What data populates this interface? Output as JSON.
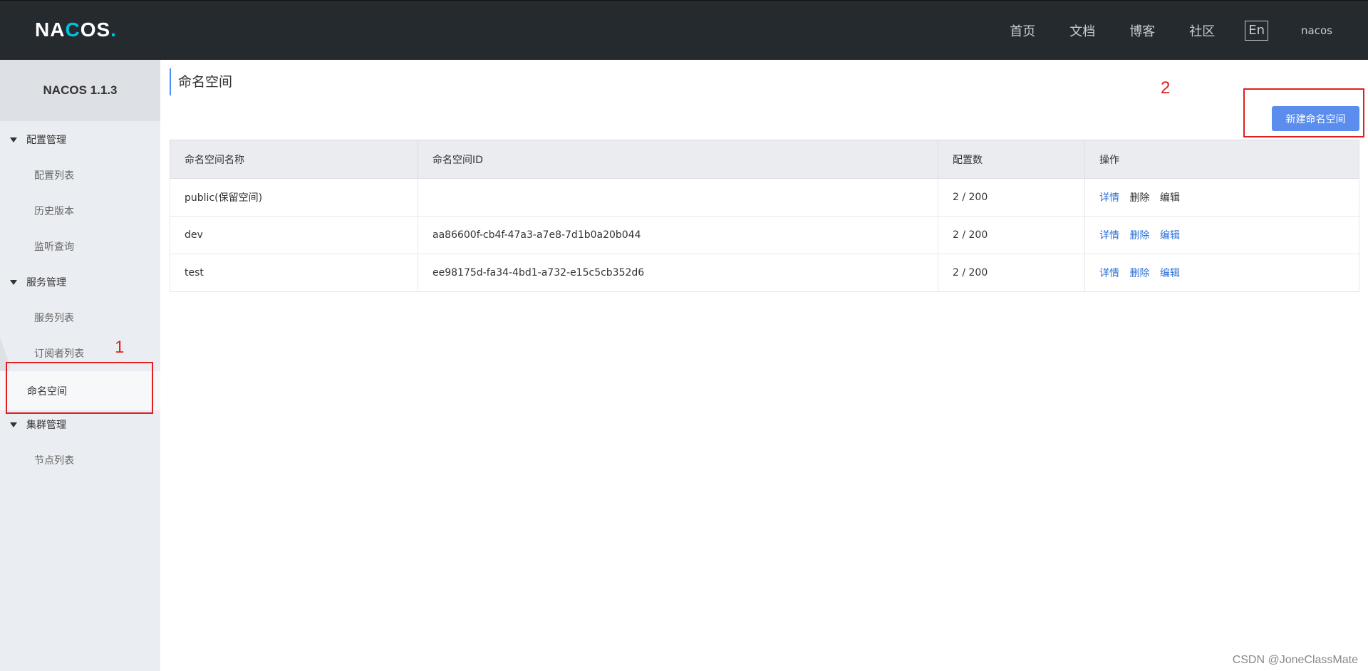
{
  "header": {
    "logo_text_1": "NA",
    "logo_text_2": "C",
    "logo_text_3": "OS",
    "logo_dot": ".",
    "nav": [
      "首页",
      "文档",
      "博客",
      "社区"
    ],
    "lang": "En",
    "user": "nacos"
  },
  "sidebar": {
    "title": "NACOS 1.1.3",
    "groups": [
      {
        "label": "配置管理",
        "items": [
          "配置列表",
          "历史版本",
          "监听查询"
        ]
      },
      {
        "label": "服务管理",
        "items": [
          "服务列表",
          "订阅者列表",
          "命名空间"
        ]
      },
      {
        "label": "集群管理",
        "items": [
          "节点列表"
        ]
      }
    ],
    "active_item": "命名空间"
  },
  "main": {
    "page_title": "命名空间",
    "create_button": "新建命名空间",
    "table": {
      "headers": [
        "命名空间名称",
        "命名空间ID",
        "配置数",
        "操作"
      ],
      "rows": [
        {
          "name": "public(保留空间)",
          "id": "",
          "count": "2 / 200",
          "ops": [
            "详情",
            "删除",
            "编辑"
          ]
        },
        {
          "name": "dev",
          "id": "aa86600f-cb4f-47a3-a7e8-7d1b0a20b044",
          "count": "2 / 200",
          "ops": [
            "详情",
            "删除",
            "编辑"
          ]
        },
        {
          "name": "test",
          "id": "ee98175d-fa34-4bd1-a732-e15c5cb352d6",
          "count": "2 / 200",
          "ops": [
            "详情",
            "删除",
            "编辑"
          ]
        }
      ]
    }
  },
  "annotations": {
    "one": "1",
    "two": "2"
  },
  "watermark": "CSDN @JoneClassMate",
  "colors": {
    "header_bg": "#252a2f",
    "accent": "#5b8def",
    "link": "#2a6fd6",
    "annotation": "#e02020"
  }
}
